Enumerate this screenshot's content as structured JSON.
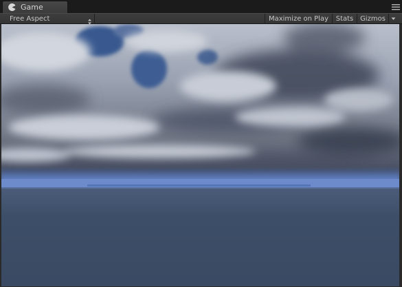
{
  "panel": {
    "tab_label": "Game",
    "tab_icon": "pacman-game-icon",
    "menu_icon": "panel-menu-icon"
  },
  "toolbar": {
    "aspect_label": "Free Aspect",
    "maximize_label": "Maximize on Play",
    "stats_label": "Stats",
    "gizmos_label": "Gizmos"
  },
  "colors": {
    "sky_blue": "#39598f",
    "horizon": "#6b89c8",
    "sea": "#3a4b64",
    "cloud": "#c6cbd6"
  }
}
